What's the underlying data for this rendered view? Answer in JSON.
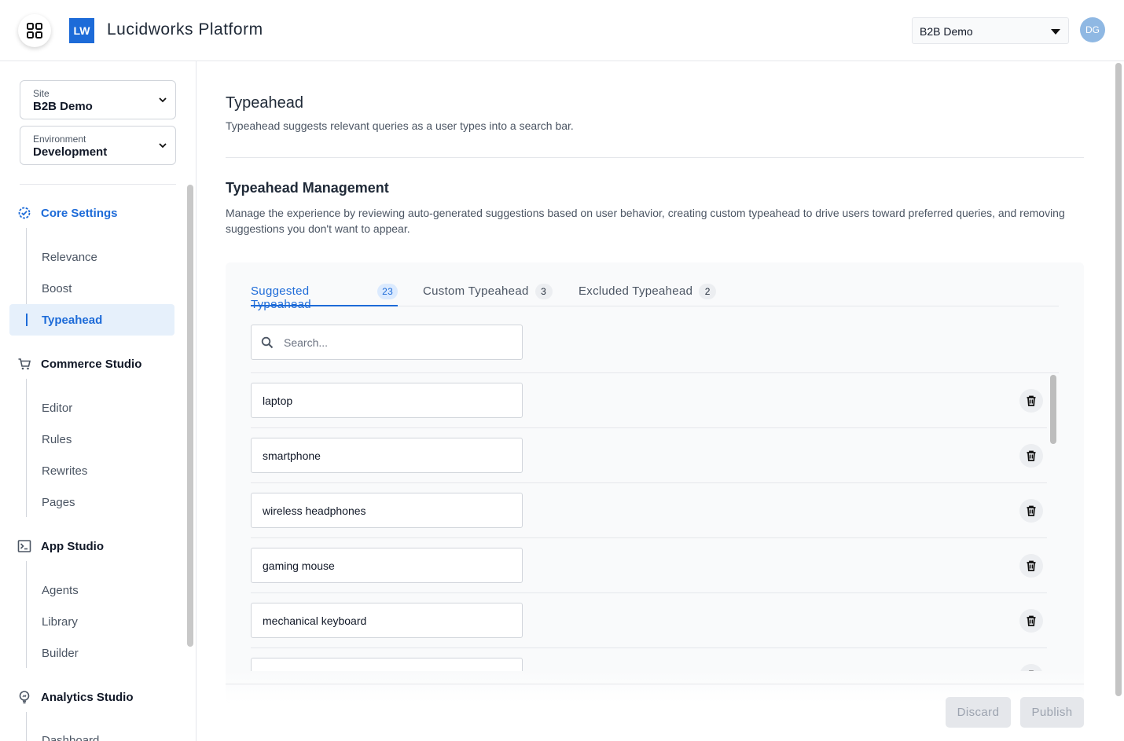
{
  "header": {
    "logo_text": "LW",
    "app_title": "Lucidworks Platform",
    "site_select_value": "B2B Demo",
    "avatar_initials": "DG"
  },
  "sidebar": {
    "site": {
      "label": "Site",
      "value": "B2B Demo"
    },
    "environment": {
      "label": "Environment",
      "value": "Development"
    },
    "sections": [
      {
        "title": "Core Settings",
        "icon": "gear-check-icon",
        "items": [
          "Relevance",
          "Boost",
          "Typeahead"
        ]
      },
      {
        "title": "Commerce Studio",
        "icon": "cart-icon",
        "items": [
          "Editor",
          "Rules",
          "Rewrites",
          "Pages"
        ]
      },
      {
        "title": "App Studio",
        "icon": "terminal-icon",
        "items": [
          "Agents",
          "Library",
          "Builder"
        ]
      },
      {
        "title": "Analytics Studio",
        "icon": "lightbulb-icon",
        "items": [
          "Dashboard"
        ]
      }
    ],
    "active_item": "Typeahead"
  },
  "main": {
    "title": "Typeahead",
    "subtitle": "Typeahead suggests relevant queries as a user types into a search bar.",
    "management_title": "Typeahead Management",
    "management_desc": "Manage the experience by reviewing auto-generated suggestions based on user behavior, creating custom typeahead to drive users toward preferred queries, and removing suggestions you don't want to appear.",
    "tabs": [
      {
        "label": "Suggested Typeahead",
        "count": "23",
        "active": true
      },
      {
        "label": "Custom Typeahead",
        "count": "3",
        "active": false
      },
      {
        "label": "Excluded Typeahead",
        "count": "2",
        "active": false
      }
    ],
    "search_placeholder": "Search...",
    "rows": [
      "laptop",
      "smartphone",
      "wireless headphones",
      "gaming mouse",
      "mechanical keyboard",
      ""
    ],
    "actions": {
      "discard": "Discard",
      "publish": "Publish"
    }
  },
  "colors": {
    "accent": "#1d6bd8",
    "active_bg": "#e6f0fb"
  }
}
